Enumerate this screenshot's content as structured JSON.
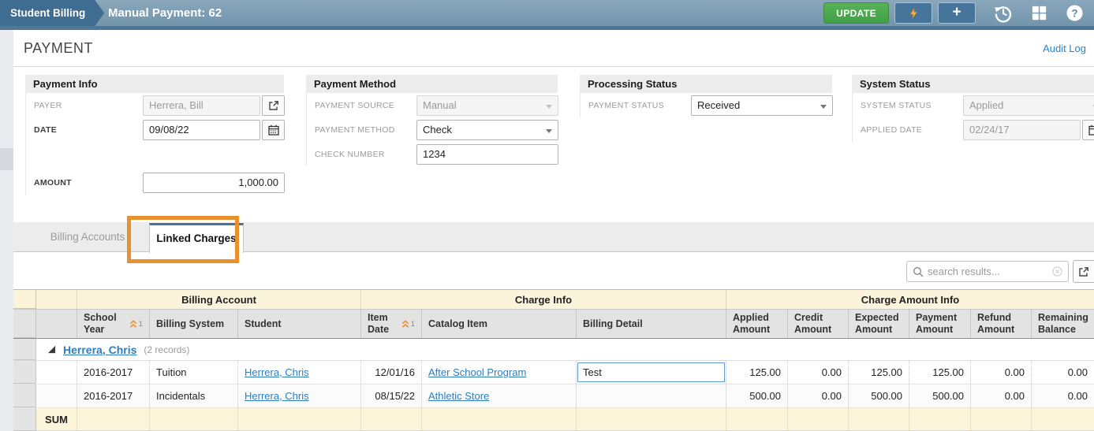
{
  "colors": {
    "topbar_blue": "#6e93ab",
    "breadcrumb_blue": "#3f6d92",
    "update_green": "#42a047",
    "lightning_gold": "#f9b233",
    "highlight_orange": "#e8912d",
    "link_blue": "#2d7dbf",
    "active_tab_accent": "#48749a",
    "group_header_cream": "#fbf4da",
    "sum_row_cream": "#fdf5d9"
  },
  "topbar": {
    "breadcrumb": "Student Billing",
    "title": "Manual Payment: 62",
    "update_label": "UPDATE",
    "icons": [
      "lightning-icon",
      "plus-icon",
      "history-icon",
      "apps-grid-icon",
      "help-icon"
    ]
  },
  "page": {
    "title": "PAYMENT",
    "audit_log_label": "Audit Log"
  },
  "payment_info": {
    "title": "Payment Info",
    "payer_label": "PAYER",
    "payer_value": "Herrera, Bill",
    "date_label": "DATE",
    "date_value": "09/08/22",
    "amount_label": "AMOUNT",
    "amount_value": "1,000.00"
  },
  "payment_method": {
    "title": "Payment Method",
    "source_label": "PAYMENT SOURCE",
    "source_value": "Manual",
    "method_label": "PAYMENT METHOD",
    "method_value": "Check",
    "check_label": "CHECK NUMBER",
    "check_value": "1234"
  },
  "processing_status": {
    "title": "Processing Status",
    "status_label": "PAYMENT STATUS",
    "status_value": "Received"
  },
  "system_status": {
    "title": "System Status",
    "status_label": "SYSTEM STATUS",
    "status_value": "Applied",
    "applied_label": "APPLIED DATE",
    "applied_value": "02/24/17"
  },
  "tabs": {
    "billing_accounts": "Billing Accounts",
    "linked_charges": "Linked Charges"
  },
  "search": {
    "placeholder": "search results..."
  },
  "table": {
    "group_headers": [
      "Billing Account",
      "Charge Info",
      "Charge Amount Info"
    ],
    "columns": [
      "School Year",
      "Billing System",
      "Student",
      "Item Date",
      "Catalog Item",
      "Billing Detail",
      "Applied Amount",
      "Credit Amount",
      "Expected Amount",
      "Payment Amount",
      "Refund Amount",
      "Remaining Balance"
    ],
    "sort_index": "1",
    "group": {
      "name": "Herrera, Chris",
      "records": "(2 records)"
    },
    "rows": [
      {
        "school_year": "2016-2017",
        "billing_system": "Tuition",
        "student": "Herrera, Chris",
        "item_date": "12/01/16",
        "catalog_item": "After School Program",
        "billing_detail": "Test",
        "applied": "125.00",
        "credit": "0.00",
        "expected": "125.00",
        "payment": "125.00",
        "refund": "0.00",
        "remaining": "0.00"
      },
      {
        "school_year": "2016-2017",
        "billing_system": "Incidentals",
        "student": "Herrera, Chris",
        "item_date": "08/15/22",
        "catalog_item": "Athletic Store",
        "billing_detail": "",
        "applied": "500.00",
        "credit": "0.00",
        "expected": "500.00",
        "payment": "500.00",
        "refund": "0.00",
        "remaining": "0.00"
      }
    ],
    "sum_label": "SUM"
  }
}
